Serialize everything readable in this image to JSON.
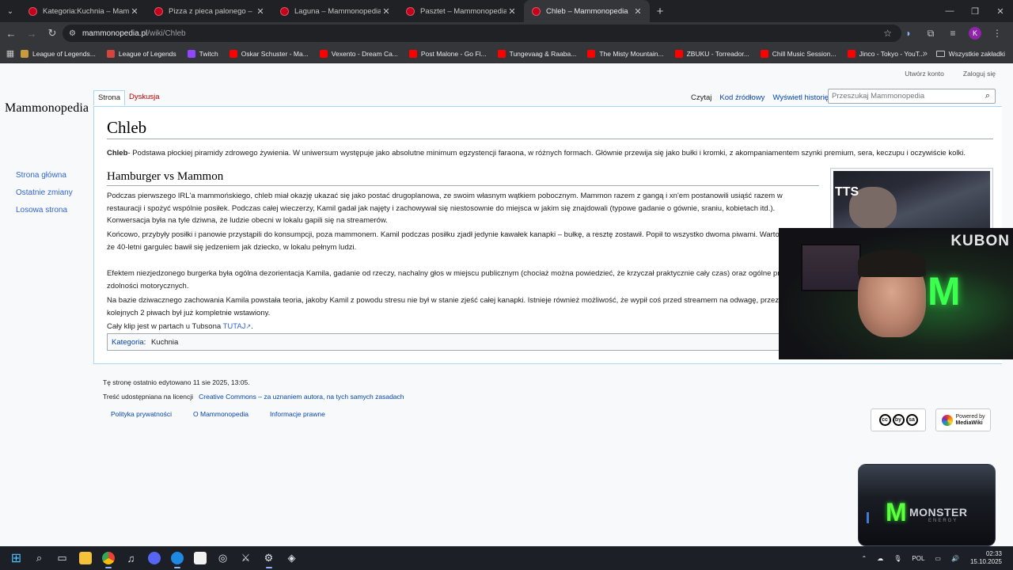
{
  "browser": {
    "tabs": [
      {
        "title": "Kategoria:Kuchnia – Mammonopedia",
        "active": false
      },
      {
        "title": "Pizza z pieca palonego – Mammonopedia",
        "active": false
      },
      {
        "title": "Laguna – Mammonopedia",
        "active": false
      },
      {
        "title": "Pasztet – Mammonopedia",
        "active": false
      },
      {
        "title": "Chleb – Mammonopedia",
        "active": true
      }
    ],
    "url_domain": "mammonopedia.pl",
    "url_path": "/wiki/Chleb",
    "profile_initial": "K",
    "bookmarks": [
      {
        "label": "League of Legends...",
        "color": "#c89b3c"
      },
      {
        "label": "League of Legends",
        "color": "#d6453d"
      },
      {
        "label": "Twitch",
        "color": "#9146ff"
      },
      {
        "label": "Oskar Schuster - Ma...",
        "color": "#ff0000"
      },
      {
        "label": "Vexento - Dream Ca...",
        "color": "#ff0000"
      },
      {
        "label": "Post Malone - Go Fl...",
        "color": "#ff0000"
      },
      {
        "label": "Tungevaag & Raaba...",
        "color": "#ff0000"
      },
      {
        "label": "The Misty Mountain...",
        "color": "#ff0000"
      },
      {
        "label": "ZBUKU - Torreador...",
        "color": "#ff0000"
      },
      {
        "label": "Chill Music Session...",
        "color": "#ff0000"
      },
      {
        "label": "Jinco - Tokyo - YouT...",
        "color": "#ff0000"
      }
    ],
    "all_bookmarks": "Wszystkie zakładki"
  },
  "wiki": {
    "personal": {
      "create_account": "Utwórz konto",
      "login": "Zaloguj się"
    },
    "logo_text": "Mammonopedia",
    "nav": [
      "Strona główna",
      "Ostatnie zmiany",
      "Losowa strona"
    ],
    "tab_page": "Strona",
    "tab_talk": "Dyskusja",
    "action_read": "Czytaj",
    "action_source": "Kod źródłowy",
    "action_history": "Wyświetl historię",
    "search_placeholder": "Przeszukaj Mammonopedia",
    "title": "Chleb",
    "lead_bold": "Chleb",
    "lead_text": "- Podstawa płockiej piramidy zdrowego żywienia. W uniwersum występuje jako absolutne minimum egzystencji faraona, w różnych formach. Głównie przewija się jako bułki i kromki, z akompaniamentem szynki premium, sera, keczupu i oczywiście kolki.",
    "section_heading": "Hamburger vs Mammon",
    "paragraphs": [
      "Podczas pierwszego IRL'a mammońskiego, chleb miał okazję ukazać się jako postać drugoplanowa, ze swoim własnym wątkiem pobocznym. Mammon razem z gangą i xn'em postanowili usiąść razem w restauracji i spożyć wspólnie posiłek. Podczas całej wieczerzy, Kamil gadał jak najęty i zachowywał się niestosownie do miejsca w jakim się znajdowali (typowe gadanie o gównie, sraniu, kobietach itd.). Konwersacja była na tyle dziwna, że ludzie obecni w lokalu gapili się na streamerów.",
      "Końcowo, przybyły posiłki i panowie przystąpili do konsumpcji, poza mammonem. Kamil podczas posiłku zjadł jedynie kawałek kanapki – bułkę, a resztę zostawił. Popił to wszystko dwoma piwami. Warto tez dodać, że 40-letni gargulec bawił się jedzeniem jak dziecko, w lokalu pełnym ludzi.",
      "Efektem niezjedzonego burgerka była ogólna dezorientacja Kamila, gadanie od rzeczy, nachalny głos w miejscu publicznym (chociaż można powiedzieć, że krzyczał praktycznie cały czas) oraz ogólne przytłumienie zdolności motorycznych.",
      "Na bazie dziwacznego zachowania Kamila powstała teoria, jakoby Kamil z powodu stresu nie był w stanie zjeść całej kanapki. Istnieje również możliwość, że wypił coś przed streamem na odwagę, przez co po kolejnych 2 piwach był już kompletnie wstawiony."
    ],
    "clip_text": "Cały klip jest w partach u Tubsona",
    "clip_link": "TUTAJ",
    "clip_link_icon": "↗",
    "thumb_text": "TTS",
    "category_label": "Kategoria",
    "category_link": "Kuchnia",
    "footer_edited": "Tę stronę ostatnio edytowano 11 sie 2025, 13:05.",
    "footer_license_prefix": "Treść udostępniana na licencji",
    "footer_license": "Creative Commons – za uznaniem autora, na tych samych zasadach",
    "footer_links": [
      "Polityka prywatności",
      "O Mammonopedia",
      "Informacje prawne"
    ],
    "cc_badge": [
      "cc",
      "by",
      "sa"
    ],
    "mediawiki_badge": [
      "Powered by",
      "MediaWiki"
    ]
  },
  "overlay": {
    "cam_label": "KUBON",
    "monster_brand": "MONSTER",
    "monster_sub": "ENERGY"
  },
  "taskbar": {
    "language": "POL",
    "time": "02:33",
    "date": "15.10.2025"
  },
  "colors": {
    "link": "#0645ad",
    "link_new": "#ba0000",
    "chrome_dark": "#202124",
    "monster_green": "#5dff3f"
  }
}
